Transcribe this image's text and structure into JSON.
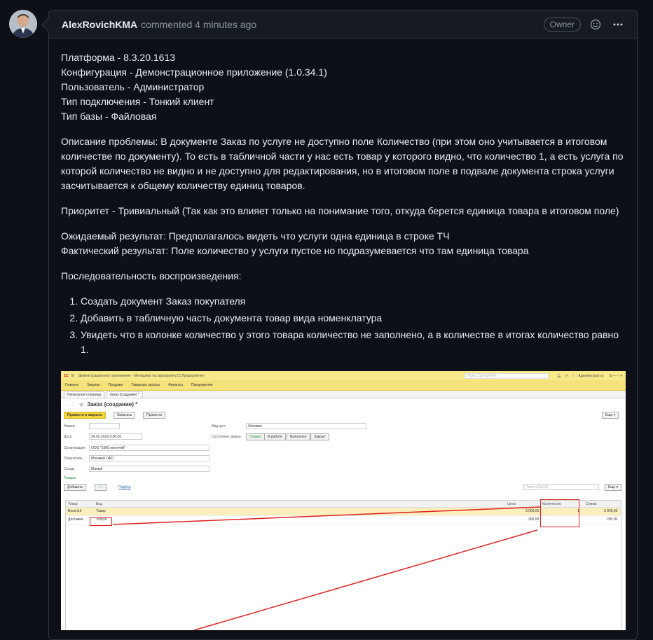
{
  "comment": {
    "author": "AlexRovichKMA",
    "meta": "commented 4 minutes ago",
    "badge": "Owner",
    "icons": {
      "reaction": "smiley-icon",
      "menu": "kebab-icon"
    }
  },
  "body": {
    "env_lines": [
      "Платформа - 8.3.20.1613",
      "Конфигурация - Демонстрационное приложение (1.0.34.1)",
      "Пользователь - Администратор",
      "Тип подключения - Тонкий клиент",
      "Тип базы - Файловая"
    ],
    "problem": "Описание проблемы: В документе Заказ по услуге не доступно поле Количество (при этом оно учитывается в итоговом количестве по документу). То есть в табличной части у нас есть товар у которого видно, что количество 1, а есть услуга по которой количество не видно и не доступно для редактирования, но в итоговом поле в подвале документа строка услуги засчитывается к общему количеству единиц товаров.",
    "priority": "Приоритет - Тривиальный (Так как это влияет только на понимание того, откуда берется единица товара в итоговом поле)",
    "expected": "Ожидаемый результат: Предполагалось видеть что услуги одна единица в строке ТЧ",
    "actual": "Фактический результат: Поле количество у услуги пустое но подразумевается что там единица товара",
    "steps_title": "Последовательность воспроизведения:",
    "steps": [
      "Создать документ Заказ покупателя",
      "Добавить в табличную часть документа товар вида номенклатура",
      "Увидеть что в колонке количество у этого товара количество не заполнено, а в количестве в итогах количество равно 1."
    ]
  },
  "screenshot": {
    "window_title": "Демонстрационное приложение - Менеджер тестирования (1С:Предприятие)",
    "search_placeholder": "Поиск Ctrl+Shift+F",
    "user": "Администратор",
    "menu": [
      "Главное",
      "Закупки",
      "Продажи",
      "Товарные запасы",
      "Финансы",
      "Предприятие"
    ],
    "tabs": [
      "Начальная страница",
      "Заказ (создание) *"
    ],
    "doc_title": "Заказ (создание) *",
    "buttons": {
      "post_close": "Провести и закрыть",
      "save": "Записать",
      "post": "Провести",
      "more": "Еще ▾",
      "add": "Добавить",
      "select": "Подбор",
      "more2": "Еще ▾"
    },
    "fields": {
      "number_label": "Номер:",
      "number": "",
      "date_label": "Дата:",
      "date": "24.02.2022  0:00:00",
      "org_label": "Организация:",
      "org": "ООО \"1000 мелочей\"",
      "buyer_label": "Покупатель:",
      "buyer": "Москвей ОАО",
      "warehouse_label": "Склад:",
      "warehouse": "Малый",
      "price_type_label": "Вид цен:",
      "price_type": "Оптовая",
      "state_label": "Состояние заказа:",
      "states": [
        "Открыт",
        "В работе",
        "Выполнен",
        "Закрыт"
      ]
    },
    "goods_label": "Товары",
    "table_search_placeholder": "Поиск (Ctrl+F)",
    "table": {
      "headers": [
        "Товар",
        "Вид",
        "Цена",
        "Количество",
        "Сумма"
      ],
      "rows": [
        {
          "item": "Bosch15",
          "kind": "Товар",
          "price": "3 000,00",
          "qty": "1",
          "sum": "3 000,00"
        },
        {
          "item": "Доставка",
          "kind": "Услуга",
          "price": "200,00",
          "qty": "",
          "sum": "200,00"
        }
      ]
    }
  }
}
